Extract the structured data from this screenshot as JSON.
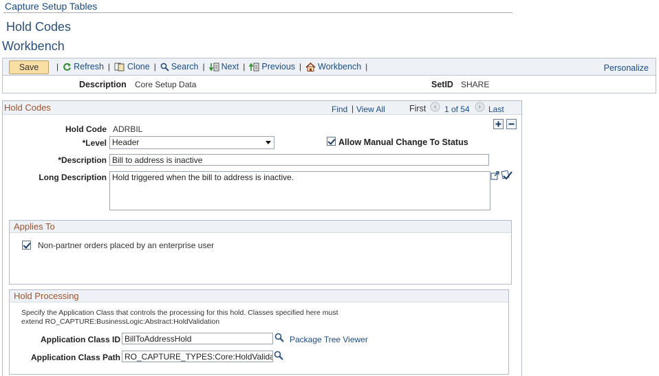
{
  "breadcrumb": "Capture Setup Tables",
  "page_title": "Hold Codes",
  "subtitle": "Workbench",
  "toolbar": {
    "save": "Save",
    "refresh": "Refresh",
    "clone": "Clone",
    "search": "Search",
    "next": "Next",
    "previous": "Previous",
    "workbench": "Workbench",
    "personalize": "Personalize",
    "separator": "|"
  },
  "header": {
    "description_label": "Description",
    "description_value": "Core Setup Data",
    "setid_label": "SetID",
    "setid_value": "SHARE"
  },
  "hold_codes": {
    "title": "Hold Codes",
    "find": "Find",
    "view_all": "View All",
    "first": "First",
    "counter": "1 of 54",
    "last": "Last",
    "separator": "|",
    "hold_code_label": "Hold Code",
    "hold_code_value": "ADRBIL",
    "level_label": "*Level",
    "level_value": "Header",
    "allow_manual_label": "Allow Manual Change To Status",
    "allow_manual_checked": true,
    "description_label": "*Description",
    "description_value": "Bill to address is inactive",
    "long_description_label": "Long Description",
    "long_description_value": "Hold triggered when the bill to address is inactive."
  },
  "applies_to": {
    "title": "Applies To",
    "option_label": "Non-partner orders placed by an enterprise user",
    "option_checked": true
  },
  "hold_processing": {
    "title": "Hold Processing",
    "instructions_line1": "Specify the Application Class that controls the processing for this hold. Classes specified here must",
    "instructions_line2": "extend RO_CAPTURE:BusinessLogic:Abstract:HoldValidation",
    "app_class_id_label": "Application Class ID",
    "app_class_id_value": "BillToAddressHold",
    "package_tree_viewer": "Package Tree Viewer",
    "app_class_path_label": "Application Class Path",
    "app_class_path_value": "RO_CAPTURE_TYPES:Core:HoldValidation"
  },
  "colors": {
    "link": "#1a4b87",
    "group_title": "#a0522d",
    "save_button_bg": "#f9dfa3",
    "toolbar_bg": "#eef2f6",
    "border": "#b0bcc8"
  }
}
